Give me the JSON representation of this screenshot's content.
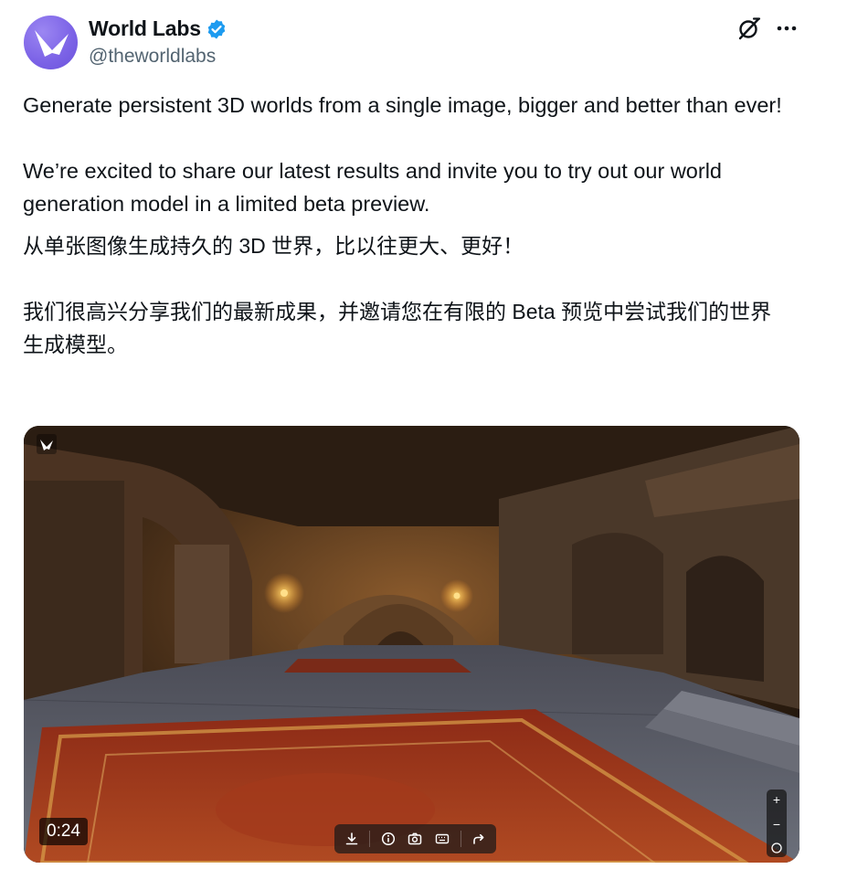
{
  "author": {
    "name": "World Labs",
    "handle": "@theworldlabs",
    "verified": true,
    "avatar_color": "#7b62e6"
  },
  "header_icons": [
    "grok-icon",
    "more-icon"
  ],
  "tweet": {
    "para1": "Generate persistent 3D worlds from a single image, bigger and better than ever!",
    "para2": "We’re excited to share our latest results and invite you to try out our world generation model in a limited beta preview.",
    "para3_cn": "从单张图像生成持久的 3D 世界，比以往更大、更好！",
    "para4_cn": "我们很高兴分享我们的最新成果，并邀请您在有限的 Beta 预览中尝试我们的世界生成模型。"
  },
  "media": {
    "type": "video",
    "timestamp": "0:24",
    "controls": [
      "download-icon",
      "info-icon",
      "camera-icon",
      "keyboard-icon",
      "share-icon"
    ],
    "zoom_controls": {
      "plus": "+",
      "minus": "−"
    }
  },
  "colors": {
    "verified_blue": "#1d9bf0",
    "text_primary": "#0f1419",
    "text_secondary": "#536471"
  }
}
